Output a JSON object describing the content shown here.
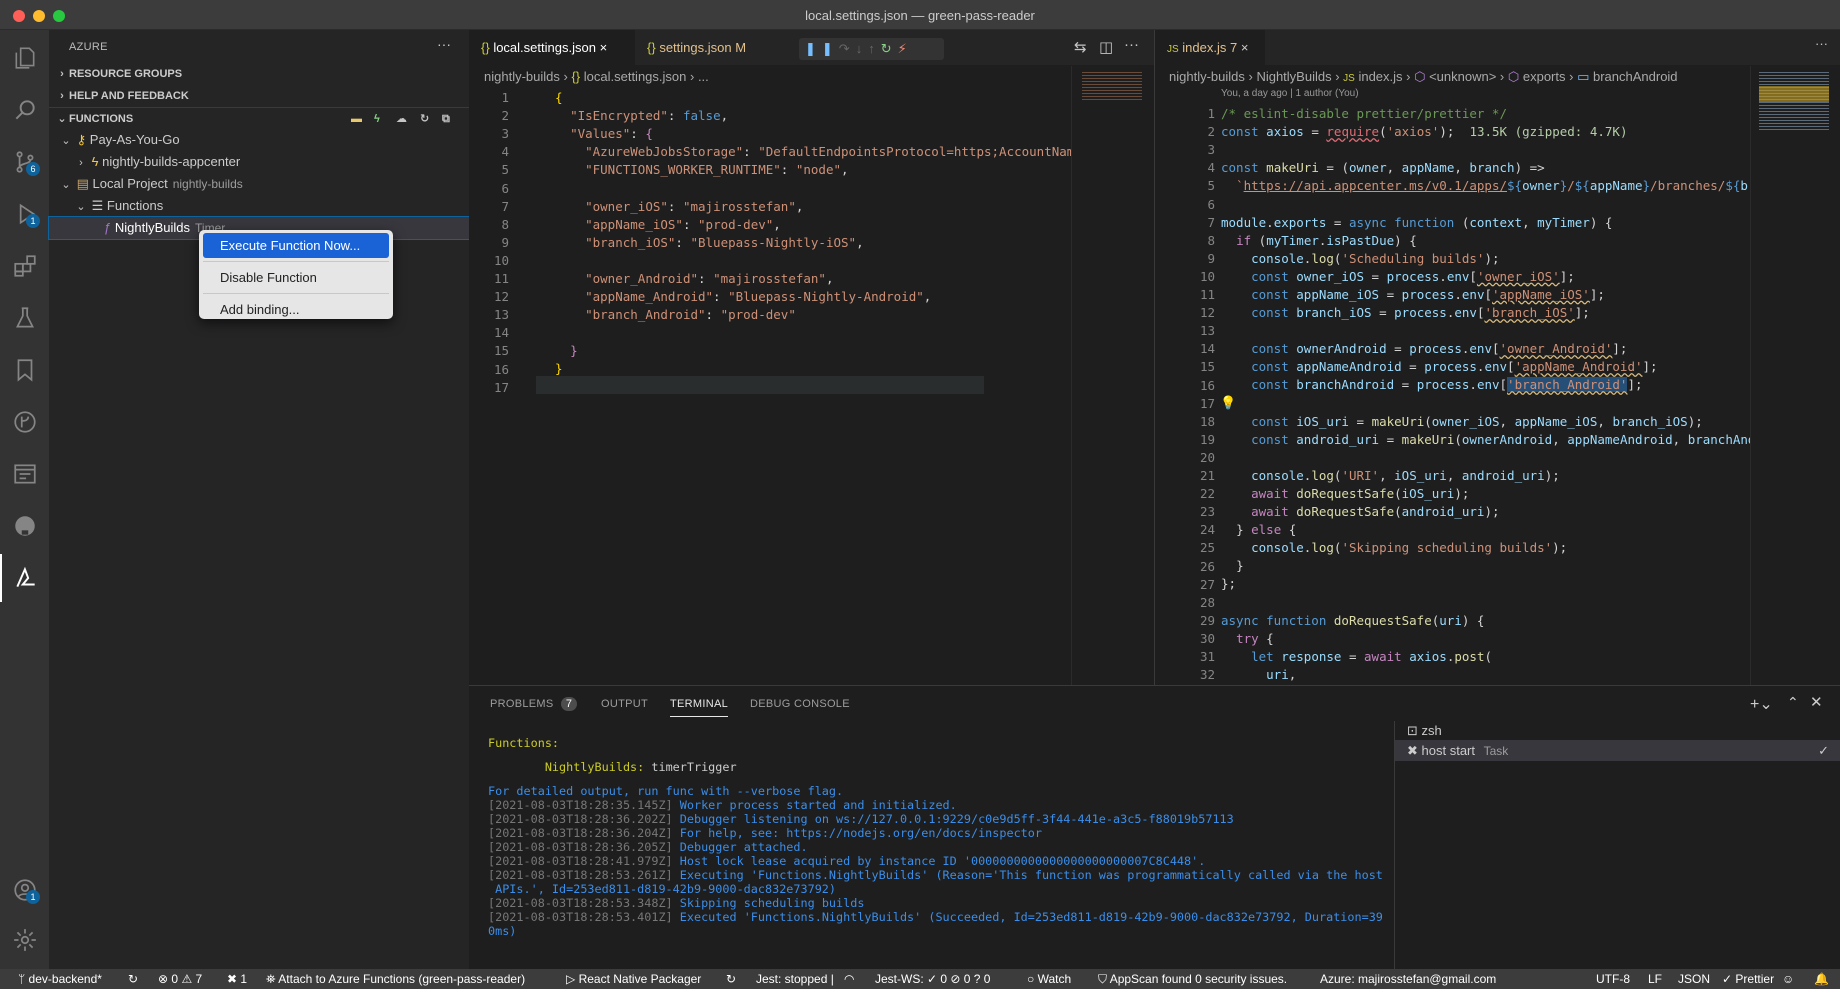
{
  "window": {
    "title": "local.settings.json — green-pass-reader"
  },
  "colors": {
    "accent": "#0e639c",
    "menu_highlight": "#1a63d6",
    "tab_modified": "#e2c08d"
  },
  "sidebar": {
    "title": "AZURE",
    "more": "···",
    "sections": {
      "resource_groups": "RESOURCE GROUPS",
      "help": "HELP AND FEEDBACK",
      "functions": "FUNCTIONS"
    },
    "tree": {
      "subscription": "Pay-As-You-Go",
      "app": "nightly-builds-appcenter",
      "local_project": "Local Project",
      "local_project_desc": "nightly-builds",
      "functions": "Functions",
      "function": "NightlyBuilds",
      "function_desc": "Timer"
    }
  },
  "context_menu": {
    "execute": "Execute Function Now...",
    "disable": "Disable Function",
    "add_binding": "Add binding..."
  },
  "editor1": {
    "tabs": [
      {
        "label": "local.settings.json",
        "close": "×"
      },
      {
        "label": "settings.json",
        "badge": "M"
      }
    ],
    "breadcrumb": {
      "folder": "nightly-builds",
      "file": "local.settings.json",
      "rest": "..."
    },
    "lines": [
      "1",
      "2",
      "3",
      "4",
      "5",
      "6",
      "7",
      "8",
      "9",
      "10",
      "11",
      "12",
      "13",
      "14",
      "15",
      "16",
      "17"
    ]
  },
  "editor2": {
    "tab": {
      "label": "index.js",
      "count": "7",
      "close": "×"
    },
    "breadcrumb": {
      "folder": "nightly-builds",
      "sub": "NightlyBuilds",
      "file": "index.js",
      "unknown": "<unknown>",
      "exports": "exports",
      "symbol": "branchAndroid"
    },
    "blame": "You, a day ago | 1 author (You)",
    "import_size": "13.5K (gzipped: 4.7K)",
    "lines": [
      "1",
      "2",
      "3",
      "4",
      "5",
      "6",
      "7",
      "8",
      "9",
      "10",
      "11",
      "12",
      "13",
      "14",
      "15",
      "16",
      "17",
      "18",
      "19",
      "20",
      "21",
      "22",
      "23",
      "24",
      "25",
      "26",
      "27",
      "28",
      "29",
      "30",
      "31",
      "32"
    ]
  },
  "panel": {
    "tabs": {
      "problems": "PROBLEMS",
      "problems_count": "7",
      "output": "OUTPUT",
      "terminal": "TERMINAL",
      "debug": "DEBUG CONSOLE"
    },
    "terminals": {
      "zsh": "zsh",
      "task": "host start",
      "task_desc": "Task"
    },
    "terminal_lines": [
      "Functions:",
      "",
      "        NightlyBuilds: timerTrigger",
      "",
      "For detailed output, run func with --verbose flag.",
      "[2021-08-03T18:28:35.145Z] Worker process started and initialized.",
      "[2021-08-03T18:28:36.202Z] Debugger listening on ws://127.0.0.1:9229/c0e9d5ff-3f44-441e-a3c5-f88019b57113",
      "[2021-08-03T18:28:36.204Z] For help, see: https://nodejs.org/en/docs/inspector",
      "[2021-08-03T18:28:36.205Z] Debugger attached.",
      "[2021-08-03T18:28:41.979Z] Host lock lease acquired by instance ID '0000000000000000000000007C8C448'.",
      "[2021-08-03T18:28:53.261Z] Executing 'Functions.NightlyBuilds' (Reason='This function was programmatically called via the host",
      " APIs.', Id=253ed811-d819-42b9-9000-dac832e73792)",
      "[2021-08-03T18:28:53.348Z] Skipping scheduling builds",
      "[2021-08-03T18:28:53.401Z] Executed 'Functions.NightlyBuilds' (Succeeded, Id=253ed811-d819-42b9-9000-dac832e73792, Duration=39",
      "0ms)"
    ]
  },
  "status": {
    "branch": "dev-backend*",
    "errors": "0",
    "warnings": "7",
    "tools": "1",
    "attach": "Attach to Azure Functions (green-pass-reader)",
    "rn": "React Native Packager",
    "jest": "Jest: stopped |",
    "jestws": "Jest-WS: ✓ 0 ⊘ 0 ? 0",
    "watch": "Watch",
    "appscan": "AppScan found 0 security issues.",
    "azure": "Azure: majirosstefan@gmail.com",
    "encoding": "UTF-8",
    "eol": "LF",
    "lang": "JSON",
    "prettier": "Prettier"
  },
  "badges": {
    "scm": "6",
    "run": "1",
    "account": "1"
  }
}
